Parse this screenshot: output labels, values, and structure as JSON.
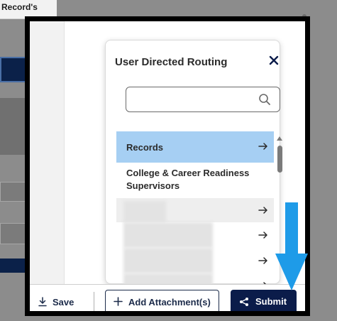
{
  "background": {
    "top_card_text": "Record's"
  },
  "routing": {
    "title": "User Directed Routing",
    "search_placeholder": "",
    "items": [
      {
        "label": "Records",
        "selected": true
      },
      {
        "label": "College & Career Readiness",
        "label_line2": "Supervisors"
      },
      {
        "label": ""
      },
      {
        "label": ""
      },
      {
        "label": ""
      },
      {
        "label": ""
      }
    ]
  },
  "footer": {
    "save_label": "Save",
    "attach_label": "Add Attachment(s)",
    "submit_label": "Submit"
  },
  "colors": {
    "navy": "#0b1c4a",
    "selected_row": "#a6cff3",
    "annotation_arrow": "#1e9be8",
    "annotation_frame": "#000000"
  },
  "icons": {
    "close": "close-icon",
    "search": "search-icon",
    "arrow": "arrow-right-icon",
    "save": "download-icon",
    "attach": "plus-icon",
    "submit": "share-icon"
  }
}
